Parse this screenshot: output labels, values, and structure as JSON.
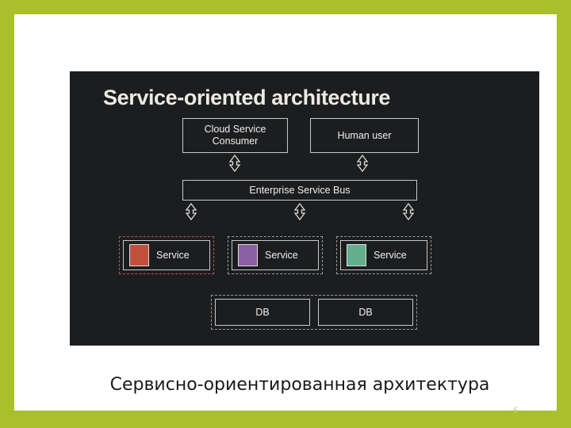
{
  "slide": {
    "border_color": "#A9C02C",
    "background_color": "#FFFFFF",
    "page_number": "6",
    "caption": "Сервисно-ориентированная архитектура"
  },
  "diagram": {
    "background_color": "#1C1D1F",
    "title": "Service-oriented architecture",
    "consumers": [
      {
        "label": "Cloud Service Consumer"
      },
      {
        "label": "Human user"
      }
    ],
    "bus": {
      "label": "Enterprise Service Bus"
    },
    "services": [
      {
        "label": "Service",
        "swatch_color": "#C0503C",
        "group_border_color": "#B25B4C"
      },
      {
        "label": "Service",
        "swatch_color": "#8A5FA3",
        "group_border_color": "#9A9A9A"
      },
      {
        "label": "Service",
        "swatch_color": "#63AF8C",
        "group_border_color": "#9A9A9A"
      }
    ],
    "databases": [
      {
        "label": "DB"
      },
      {
        "label": "DB"
      }
    ],
    "arrows": [
      {
        "name": "consumer-to-bus",
        "direction": "double-vertical"
      },
      {
        "name": "human-to-bus",
        "direction": "double-vertical"
      },
      {
        "name": "bus-to-service-1",
        "direction": "double-vertical"
      },
      {
        "name": "bus-to-service-2",
        "direction": "double-vertical"
      },
      {
        "name": "bus-to-service-3",
        "direction": "double-vertical"
      }
    ]
  }
}
